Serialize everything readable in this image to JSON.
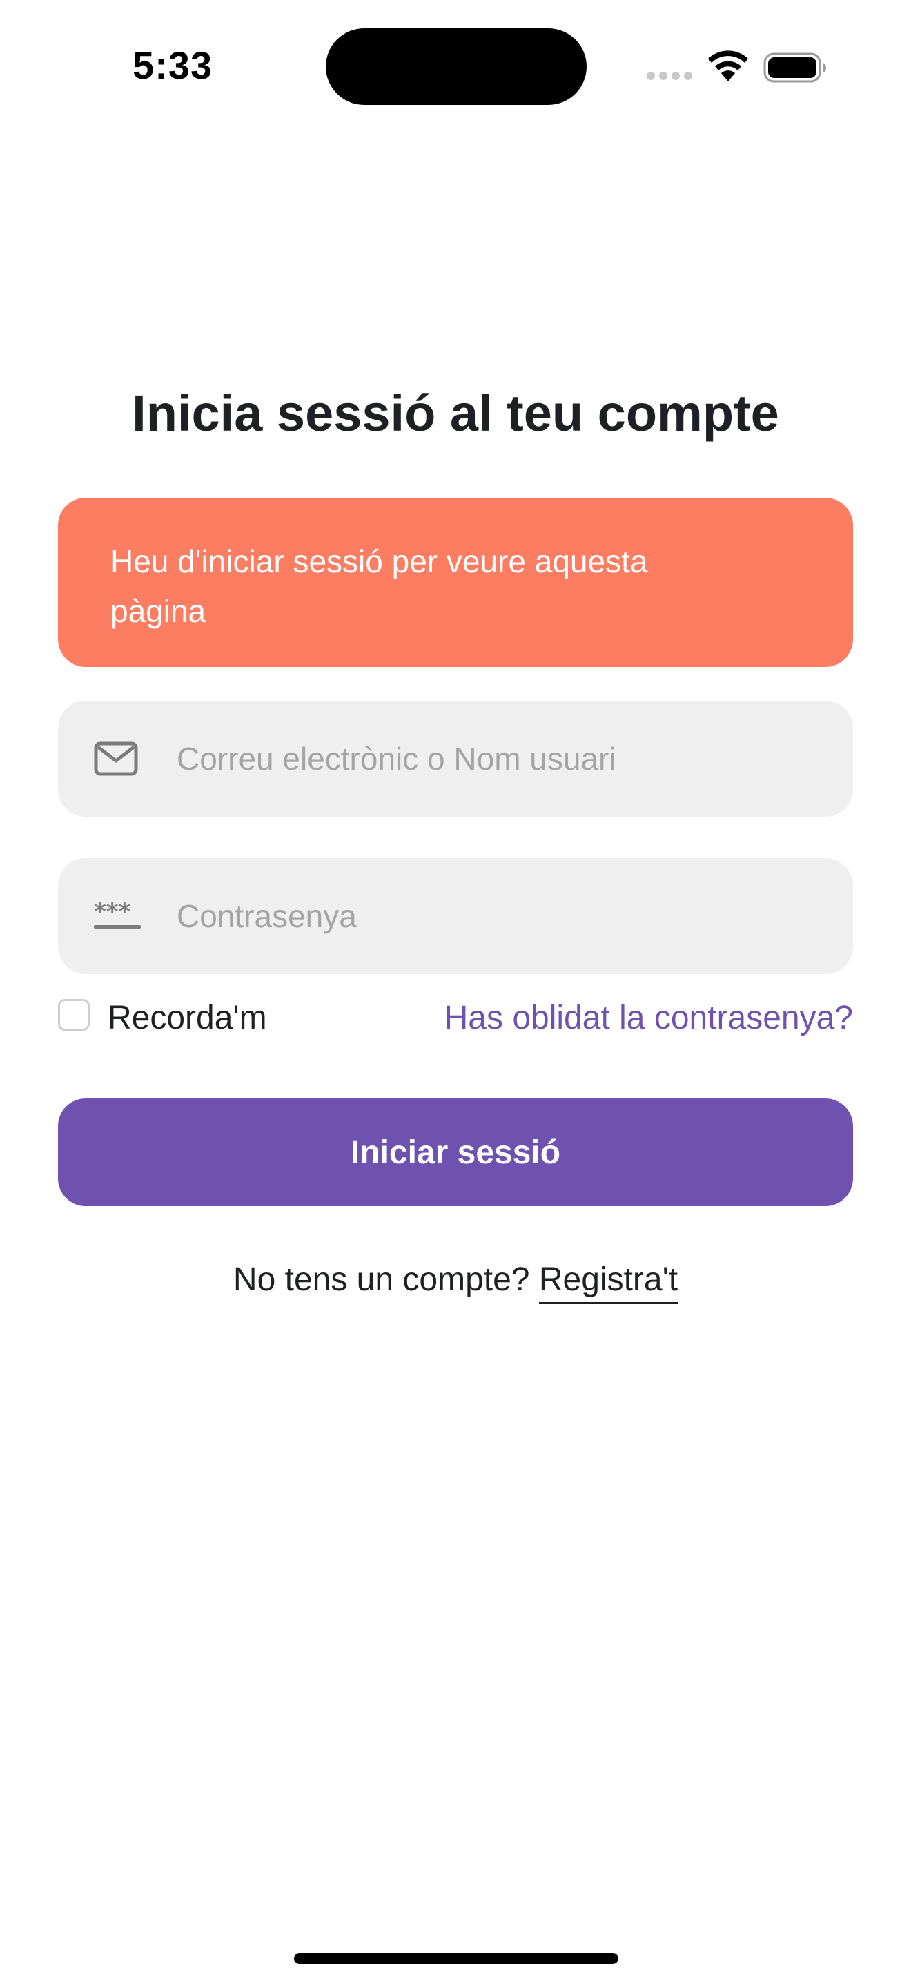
{
  "status_bar": {
    "time": "5:33",
    "icons": [
      "signal-icon",
      "wifi-icon",
      "battery-icon"
    ]
  },
  "login": {
    "title": "Inicia sessió al teu compte",
    "alert": "Heu d'iniciar sessió per veure aquesta pàgina",
    "email_placeholder": "Correu electrònic o Nom usuari",
    "password_placeholder": "Contrasenya",
    "remember_label": "Recorda'm",
    "remember_checked": false,
    "forgot_link": "Has oblidat la contrasenya?",
    "submit_label": "Iniciar sessió",
    "signup_prompt": "No tens un compte?",
    "signup_link": "Registra't"
  },
  "colors": {
    "alert_background": "#fd7d62",
    "accent": "#6f51b0",
    "field_background": "#efefef",
    "text": "#1f2024",
    "placeholder": "#a4a4a4"
  }
}
